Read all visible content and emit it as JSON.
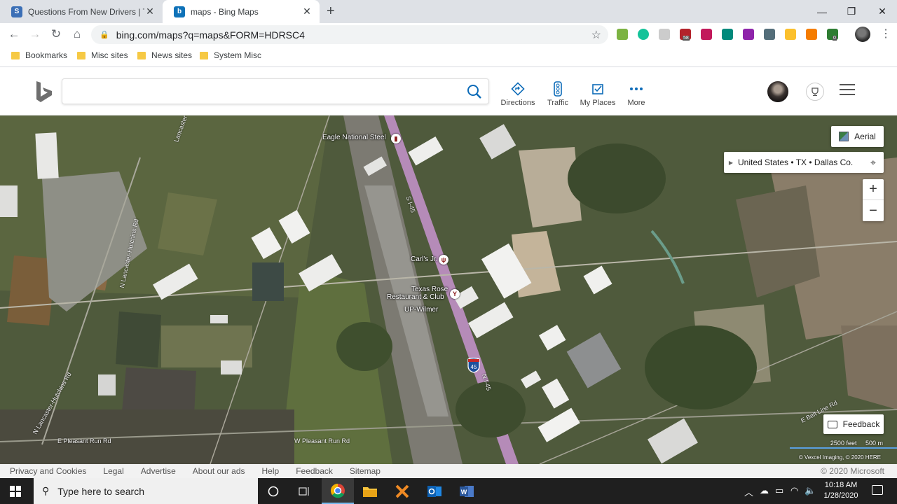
{
  "browser": {
    "tabs": [
      {
        "title": "Questions From New Drivers | Tru",
        "favicon_color": "#3b6fb6"
      },
      {
        "title": "maps - Bing Maps",
        "favicon_color": "#0f72b8"
      }
    ],
    "url": "bing.com/maps?q=maps&FORM=HDRSC4",
    "bookmarks": [
      "Bookmarks",
      "Misc sites",
      "News sites",
      "System Misc"
    ],
    "extension_badges": {
      "badge1": "58",
      "badge2": "0"
    }
  },
  "bing": {
    "search_placeholder": "",
    "nav": [
      {
        "label": "Directions",
        "icon": "directions-icon"
      },
      {
        "label": "Traffic",
        "icon": "traffic-icon"
      },
      {
        "label": "My Places",
        "icon": "my-places-icon"
      },
      {
        "label": "More",
        "icon": "more-icon"
      }
    ],
    "accent": "#0c6bb8"
  },
  "map": {
    "style_button": "Aerial",
    "breadcrumb": "United States • TX • Dallas Co.",
    "zoom_in": "+",
    "zoom_out": "−",
    "feedback": "Feedback",
    "scale_feet": "2500 feet",
    "scale_meters": "500 m",
    "copyright": "© Vexcel Imaging, © 2020 HERE",
    "labels": {
      "eagle": "Eagle National Steel",
      "carls": "Carl's Jr.",
      "texas_rose_1": "Texas Rose",
      "texas_rose_2": "Restaurant & Club",
      "up_wilmer": "UP-Wilmer",
      "i45_a": "S I-45",
      "i45_b": "N I-45",
      "interstate": "45",
      "lancaster_top": "Lancaster",
      "n_lancaster_hutchins": "N Lancaster-Hutchins Rd",
      "n_lancaster_hutchins_2": "N Lancaster-Hutchins Rd",
      "e_pleasant_run": "E Pleasant Run Rd",
      "w_pleasant_run": "W Pleasant Run Rd",
      "e_belt_line": "E Belt Line Rd"
    }
  },
  "footer": {
    "links": [
      "Privacy and Cookies",
      "Legal",
      "Advertise",
      "About our ads",
      "Help",
      "Feedback",
      "Sitemap"
    ],
    "copyright": "© 2020 Microsoft"
  },
  "taskbar": {
    "search_placeholder": "Type here to search",
    "time": "10:18 AM",
    "date": "1/28/2020"
  }
}
